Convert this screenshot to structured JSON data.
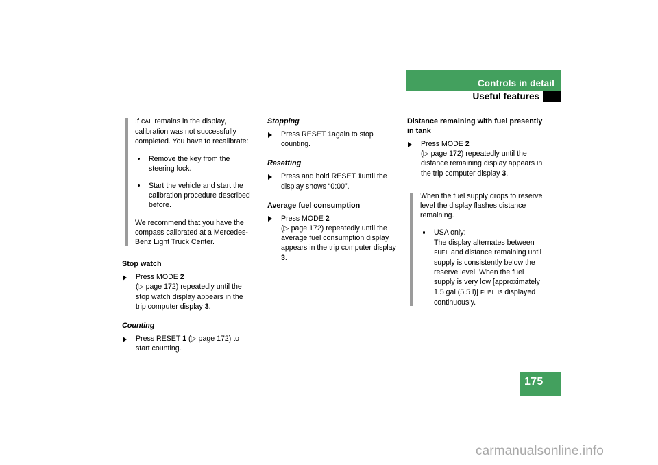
{
  "colors": {
    "accent_green": "#43a05e",
    "note_gray": "#9b9b9b",
    "watermark_gray": "#a8a8a8",
    "text_black": "#000000",
    "marker_black": "#000000"
  },
  "header": {
    "chapter_title": "Controls in detail",
    "section_title": "Useful features"
  },
  "page_number": "175",
  "watermark": "carmanualsonline.info",
  "page_ref_glyph": "▷",
  "step_glyph": "▶",
  "info_glyph": "i",
  "column1": {
    "note": {
      "intro": [
        "If ",
        "CAL",
        " remains in the display, calibration was not successfully completed. You have to recalibrate:"
      ],
      "intro_plain": "If CAL remains in the display, calibration was not successfully completed. You have to recalibrate:",
      "bullets": [
        "Remove the key from the steering lock.",
        "Start the vehicle and start the calibration procedure described before."
      ],
      "closing": "We recommend that you have the compass calibrated at a Mercedes-Benz Light Truck Center."
    },
    "sections": [
      {
        "heading": "Stop watch",
        "heading_style": "bold",
        "steps": [
          {
            "pre": "Press MODE ",
            "bold1": "2",
            "ref": " (▷ page 172) ",
            "mid": "repeatedly until the stop watch display appears in the trip computer display ",
            "bold2": "3",
            "post": "."
          }
        ]
      },
      {
        "heading": "Counting",
        "heading_style": "italic",
        "steps": [
          {
            "pre": "Press RESET ",
            "bold1": "1",
            "ref": " (▷ page 172) ",
            "mid": "to start counting.",
            "bold2": "",
            "post": ""
          }
        ]
      }
    ]
  },
  "column2": {
    "sections": [
      {
        "heading": "Stopping",
        "heading_style": "italic",
        "steps": [
          {
            "pre": "Press RESET ",
            "bold1": "1",
            "ref": " ",
            "mid": "again to stop counting.",
            "bold2": "",
            "post": ""
          }
        ]
      },
      {
        "heading": "Resetting",
        "heading_style": "italic",
        "steps": [
          {
            "pre": "Press and hold RESET ",
            "bold1": "1",
            "ref": " ",
            "mid": "until the display shows “0:00”.",
            "bold2": "",
            "post": ""
          }
        ]
      },
      {
        "heading": "Average fuel consumption",
        "heading_style": "bold",
        "steps": [
          {
            "pre": "Press MODE ",
            "bold1": "2",
            "ref": " (▷ page 172) ",
            "mid": "repeatedly until the average fuel consumption display appears in the trip computer display ",
            "bold2": "3",
            "post": "."
          }
        ]
      }
    ]
  },
  "column3": {
    "heading": "Distance remaining with fuel presently in tank",
    "step": {
      "pre": "Press MODE ",
      "bold1": "2",
      "ref": " (▷ page 172) ",
      "mid": "repeatedly until the distance remaining display appears in the trip computer display ",
      "bold2": "3",
      "post": "."
    },
    "note": {
      "intro": "When the fuel supply drops to reserve level the display flashes distance remaining.",
      "bullet_label": "USA only:",
      "bullet_body_1": "The display alternates between ",
      "bullet_mono_1": "FUEL",
      "bullet_body_2": " and distance remaining until supply is consistently below the reserve level. When the fuel supply is very low [approximately 1.5 gal (5.5 l)] ",
      "bullet_mono_2": "FUEL",
      "bullet_body_3": " is displayed continuously."
    }
  }
}
